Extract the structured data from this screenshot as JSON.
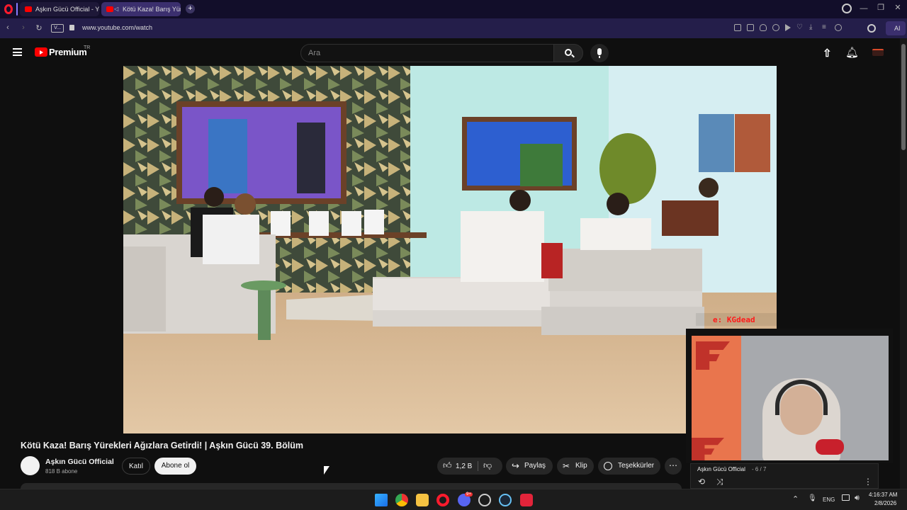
{
  "browser": {
    "tabs": [
      {
        "label": "Aşkın Gücü Official - YouT"
      },
      {
        "label": "Kötü Kaza! Barış Yüreki"
      }
    ],
    "url": "www.youtube.com/watch",
    "vpn_label": "V...",
    "ai_label": "AI"
  },
  "youtube": {
    "logo_text": "Premium",
    "region": "TR",
    "search_placeholder": "Ara"
  },
  "video": {
    "overlay_text": "e: KGdead"
  },
  "webcam": {
    "channel": "Aşkın Gücü Official",
    "playlist_pos": "- 6 / 7"
  },
  "details": {
    "title": "Kötü Kaza! Barış Yürekleri Ağızlara Getirdi! | Aşkın Gücü 39. Bölüm",
    "channel_name": "Aşkın Gücü Official",
    "subscribers": "818 B abone",
    "join_label": "Katıl",
    "subscribe_label": "Abone ol",
    "like_count": "1,2 B",
    "share_label": "Paylaş",
    "clip_label": "Klip",
    "thanks_label": "Teşekkürler"
  },
  "taskbar": {
    "lang": "ENG",
    "time": "4:16:37 AM",
    "date": "2/8/2026",
    "badge": "9+"
  },
  "colors": {
    "yt_red": "#ff0000",
    "opera_red": "#ff1b2d",
    "tab_active": "#3b2f6e"
  }
}
